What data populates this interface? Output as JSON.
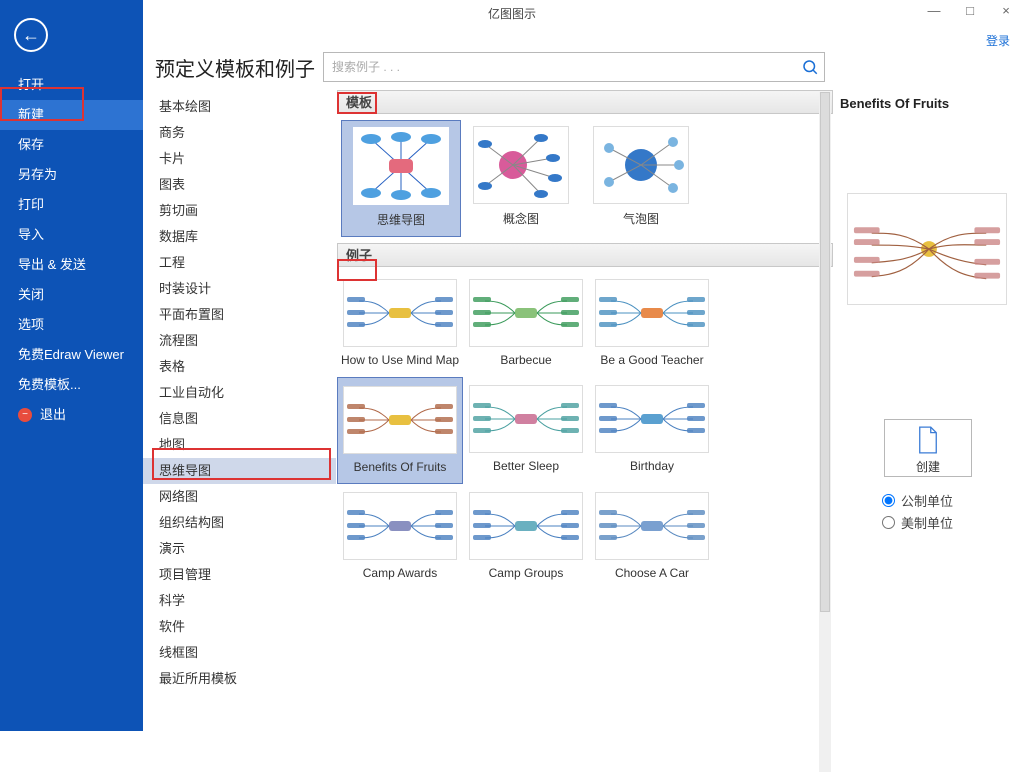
{
  "app_title": "亿图图示",
  "login_label": "登录",
  "win": {
    "min": "—",
    "max": "□",
    "close": "×"
  },
  "back_icon": "←",
  "exit_icon": "−",
  "nav": [
    {
      "label": "打开"
    },
    {
      "label": "新建",
      "selected": true
    },
    {
      "label": "保存"
    },
    {
      "label": "另存为"
    },
    {
      "label": "打印"
    },
    {
      "label": "导入"
    },
    {
      "label": "导出 & 发送"
    },
    {
      "label": "关闭"
    },
    {
      "label": "选项"
    },
    {
      "label": "免费Edraw Viewer"
    },
    {
      "label": "免费模板..."
    },
    {
      "label": "退出",
      "exit": true
    }
  ],
  "categories": [
    "基本绘图",
    "商务",
    "卡片",
    "图表",
    "剪切画",
    "数据库",
    "工程",
    "时装设计",
    "平面布置图",
    "流程图",
    "表格",
    "工业自动化",
    "信息图",
    "地图",
    "思维导图",
    "网络图",
    "组织结构图",
    "演示",
    "项目管理",
    "科学",
    "软件",
    "线框图",
    "最近所用模板"
  ],
  "selected_category_index": 14,
  "page_title": "预定义模板和例子",
  "search_placeholder": "搜索例子 . . .",
  "section_templates": "模板",
  "section_examples": "例子",
  "templates": [
    {
      "label": "思维导图",
      "kind": "mindmap",
      "selected": true
    },
    {
      "label": "概念图",
      "kind": "concept"
    },
    {
      "label": "气泡图",
      "kind": "bubble"
    }
  ],
  "examples": [
    {
      "label": "How to Use Mind Map"
    },
    {
      "label": "Barbecue"
    },
    {
      "label": "Be a Good Teacher"
    },
    {
      "label": "Benefits Of Fruits",
      "selected": true
    },
    {
      "label": "Better Sleep"
    },
    {
      "label": "Birthday"
    },
    {
      "label": "Camp Awards"
    },
    {
      "label": "Camp Groups"
    },
    {
      "label": "Choose A Car"
    }
  ],
  "right": {
    "title": "Benefits Of Fruits",
    "create_label": "创建",
    "unit_metric": "公制单位",
    "unit_imperial": "美制单位",
    "unit_selected": "metric"
  }
}
